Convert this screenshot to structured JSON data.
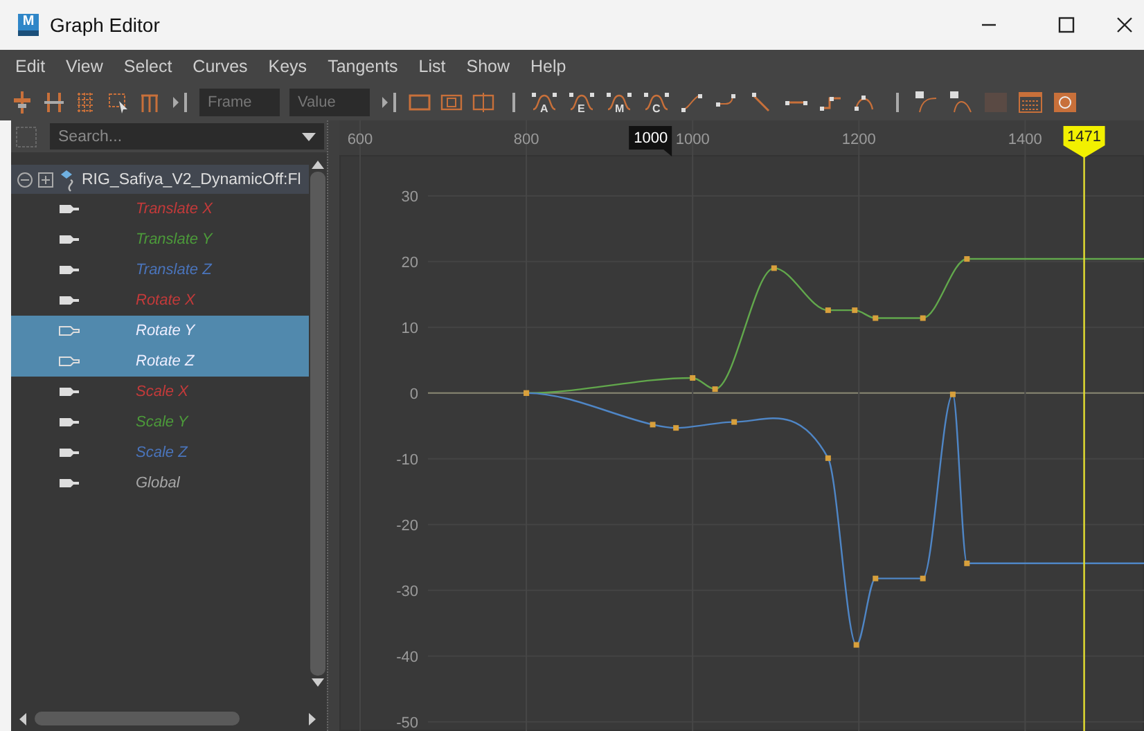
{
  "window": {
    "title": "Graph Editor",
    "app_icon_letter": "M"
  },
  "menu": [
    "Edit",
    "View",
    "Select",
    "Curves",
    "Keys",
    "Tangents",
    "List",
    "Show",
    "Help"
  ],
  "toolbar": {
    "frame_field": {
      "placeholder": "Frame"
    },
    "value_field": {
      "placeholder": "Value"
    },
    "tangent_letters": [
      "A",
      "E",
      "M",
      "C"
    ]
  },
  "outliner": {
    "search": {
      "placeholder": "Search..."
    },
    "root": {
      "label": "RIG_Safiya_V2_DynamicOff:Fl",
      "expanded": true
    },
    "items": [
      {
        "label": "Translate X",
        "color": "#c33a3a",
        "selected": false
      },
      {
        "label": "Translate Y",
        "color": "#4c9a3a",
        "selected": false
      },
      {
        "label": "Translate Z",
        "color": "#4a74bb",
        "selected": false
      },
      {
        "label": "Rotate X",
        "color": "#c33a3a",
        "selected": false
      },
      {
        "label": "Rotate Y",
        "selected": true
      },
      {
        "label": "Rotate Z",
        "selected": true
      },
      {
        "label": "Scale X",
        "color": "#c33a3a",
        "selected": false
      },
      {
        "label": "Scale Y",
        "color": "#4c9a3a",
        "selected": false
      },
      {
        "label": "Scale Z",
        "color": "#4a74bb",
        "selected": false
      },
      {
        "label": "Global",
        "color": "#a8a8a8",
        "selected": false
      }
    ]
  },
  "graph": {
    "chart_data": {
      "type": "line",
      "grid": true,
      "xlim": [
        575,
        1543
      ],
      "ylim": [
        -51.4,
        36.2
      ],
      "xticks": [
        600,
        800,
        1000,
        1200,
        1400
      ],
      "yticks": [
        30,
        20,
        10,
        0,
        -10,
        -20,
        -30,
        -40,
        -50
      ],
      "series": [
        {
          "color": "#62a84c",
          "marker": "square",
          "x": [
            800,
            1000,
            1027,
            1098,
            1163,
            1195,
            1220,
            1277,
            1330,
            1543
          ],
          "values": [
            0,
            2.3,
            0.6,
            19,
            12.6,
            12.6,
            11.4,
            11.4,
            20.4,
            20.4
          ]
        },
        {
          "color": "#4f86c6",
          "marker": "square",
          "x": [
            800,
            952,
            980,
            1050,
            1163,
            1197,
            1220,
            1277,
            1313,
            1330,
            1543
          ],
          "values": [
            0,
            -4.8,
            -5.3,
            -4.4,
            -9.9,
            -38.3,
            -28.2,
            -28.2,
            -0.2,
            -25.9,
            -25.9
          ]
        }
      ],
      "ref_lines": [
        {
          "axis": "x",
          "value": 1471,
          "label": "1471",
          "color": "#e6e030"
        }
      ]
    },
    "range_marker": {
      "label": "1000"
    }
  }
}
